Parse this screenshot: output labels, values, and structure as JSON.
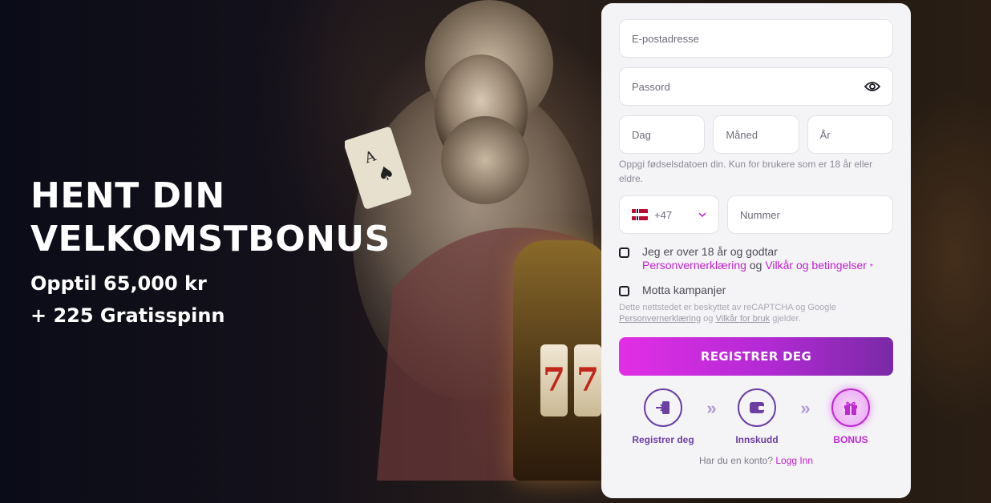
{
  "hero": {
    "title_line1": "HENT DIN",
    "title_line2": "VELKOMSTBONUS",
    "offer_line1": "Opptil 65,000 kr",
    "offer_line2": "+ 225 Gratisspinn"
  },
  "form": {
    "email_placeholder": "E-postadresse",
    "password_placeholder": "Passord",
    "day_placeholder": "Dag",
    "month_placeholder": "Måned",
    "year_placeholder": "År",
    "dob_help": "Oppgi fødselsdatoen din. Kun for brukere som er 18 år eller eldre.",
    "country_code": "+47",
    "phone_placeholder": "Nummer",
    "terms_text_1": "Jeg er over 18 år og godtar",
    "terms_link_privacy": "Personvernerklæring",
    "terms_and": "og",
    "terms_link_terms": "Vilkår og betingelser",
    "terms_required": "*",
    "promo_label": "Motta kampanjer",
    "captcha_text_1": "Dette nettstedet er beskyttet av reCAPTCHA og Google",
    "captcha_link_privacy": "Personvernerklæring",
    "captcha_and": "og",
    "captcha_link_terms": "Vilkår for bruk",
    "captcha_text_2": "gjelder.",
    "register_button": "REGISTRER DEG"
  },
  "steps": [
    {
      "label": "Registrer deg",
      "icon": "sign-in-icon"
    },
    {
      "label": "Innskudd",
      "icon": "wallet-icon"
    },
    {
      "label": "BONUS",
      "icon": "gift-icon"
    }
  ],
  "step_arrow": "»",
  "login": {
    "prompt": "Har du en konto?",
    "link": "Logg Inn"
  },
  "colors": {
    "accent": "#c21fcf",
    "step_purple": "#6b3fa3",
    "panel_bg": "#f4f4f7"
  }
}
